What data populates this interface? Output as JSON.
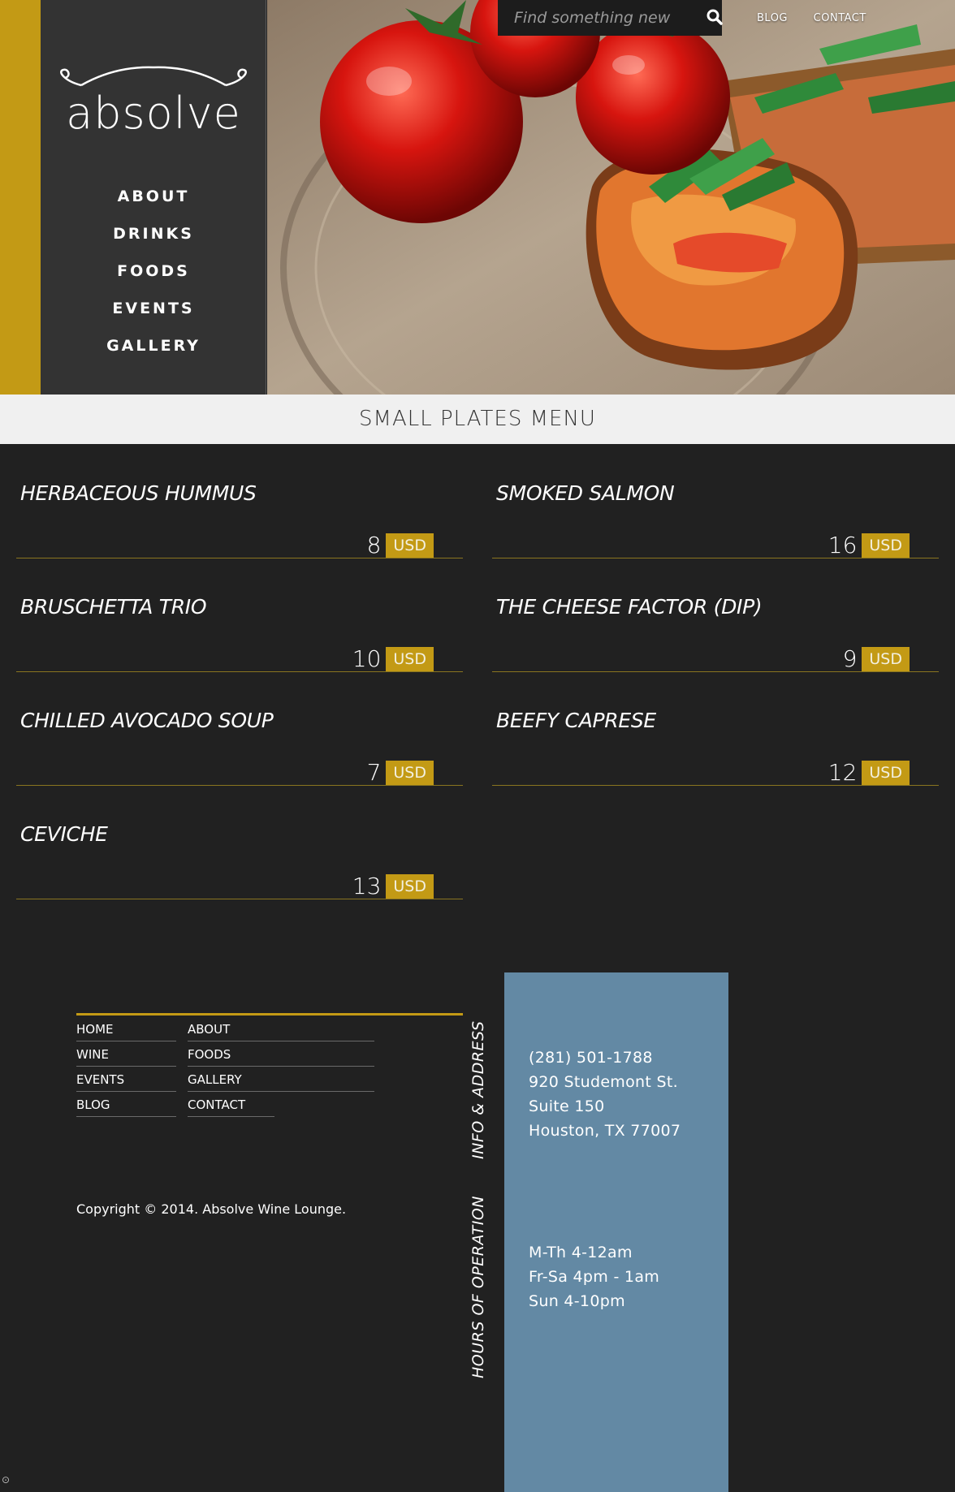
{
  "brand": {
    "logo_text": "absolve"
  },
  "main_nav": [
    "ABOUT",
    "DRINKS",
    "FOODS",
    "EVENTS",
    "GALLERY"
  ],
  "search": {
    "placeholder": "Find something new",
    "icon": "search-icon"
  },
  "top_links": [
    "BLOG",
    "CONTACT"
  ],
  "section_title": "SMALL PLATES MENU",
  "menu_items": [
    {
      "name": "HERBACEOUS HUMMUS",
      "price": "8",
      "currency": "USD"
    },
    {
      "name": "SMOKED SALMON",
      "price": "16",
      "currency": "USD"
    },
    {
      "name": "BRUSCHETTA TRIO",
      "price": "10",
      "currency": "USD"
    },
    {
      "name": "THE CHEESE FACTOR (DIP)",
      "price": "9",
      "currency": "USD"
    },
    {
      "name": "CHILLED AVOCADO SOUP",
      "price": "7",
      "currency": "USD"
    },
    {
      "name": "BEEFY CAPRESE",
      "price": "12",
      "currency": "USD"
    },
    {
      "name": "CEVICHE",
      "price": "13",
      "currency": "USD"
    }
  ],
  "footer_nav": {
    "col1": [
      "HOME",
      "WINE",
      "EVENTS",
      "BLOG"
    ],
    "col2": [
      "ABOUT",
      "FOODS",
      "GALLERY",
      "CONTACT"
    ]
  },
  "copyright": "Copyright © 2014. Absolve Wine Lounge.",
  "info_label": "INFO & ADDRESS",
  "hours_label": "HOURS OF OPERATION",
  "address": [
    "(281) 501-1788",
    "920 Studemont St.",
    "Suite 150",
    "Houston, TX 77007"
  ],
  "hours": [
    "M-Th 4-12am",
    "Fr-Sa 4pm - 1am",
    "Sun 4-10pm"
  ],
  "colors": {
    "accent_gold": "#c39a15",
    "panel_blue": "#6389a4",
    "sidebar": "#333333",
    "background": "#212121"
  }
}
